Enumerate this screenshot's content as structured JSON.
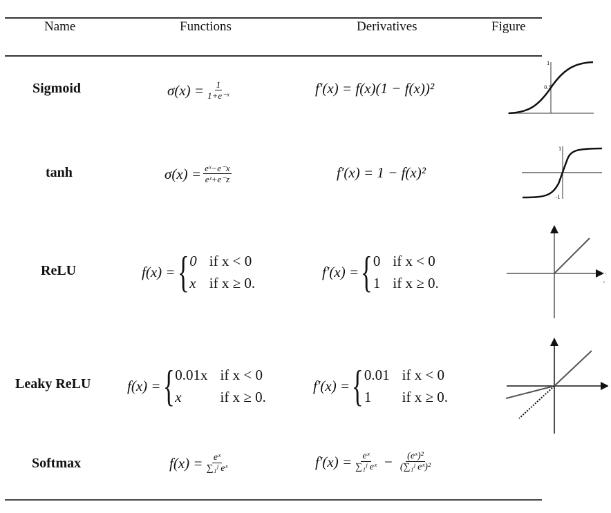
{
  "table": {
    "headers": {
      "name": "Name",
      "functions": "Functions",
      "derivatives": "Derivatives",
      "figure": "Figure"
    },
    "rows": [
      {
        "name": "Sigmoid",
        "function": {
          "lhs": "σ(x) =",
          "num": "1",
          "den": "1+e⁻ˣ"
        },
        "derivative": "f′(x) = f(x)(1 − f(x))²",
        "figure": {
          "type": "sigmoid",
          "labels": [
            "1",
            "0.5"
          ]
        }
      },
      {
        "name": "tanh",
        "function": {
          "lhs": "σ(x) =",
          "num": "eˣ−e⁻x",
          "den": "eᶻ+e⁻z"
        },
        "derivative": "f′(x) = 1 − f(x)²",
        "figure": {
          "type": "tanh",
          "labels": [
            "1",
            "-1"
          ]
        }
      },
      {
        "name": "ReLU",
        "function": {
          "lhs": "f(x) =",
          "cases": [
            [
              "0",
              "if x < 0"
            ],
            [
              "x",
              "if x ≥ 0."
            ]
          ]
        },
        "derivative": {
          "lhs": "f′(x) =",
          "cases": [
            [
              "0",
              "if x < 0"
            ],
            [
              "1",
              "if x ≥ 0."
            ]
          ]
        },
        "figure": {
          "type": "relu"
        }
      },
      {
        "name": "Leaky ReLU",
        "function": {
          "lhs": "f(x) =",
          "cases": [
            [
              "0.01x",
              "if x < 0"
            ],
            [
              "x",
              "if x ≥ 0."
            ]
          ]
        },
        "derivative": {
          "lhs": "f′(x) =",
          "cases": [
            [
              "0.01",
              "if x < 0"
            ],
            [
              "1",
              "if x ≥ 0."
            ]
          ]
        },
        "figure": {
          "type": "leaky-relu",
          "leak_slope": 0.2
        }
      },
      {
        "name": "Softmax",
        "function": {
          "lhs": "f(x) =",
          "num": "eˣ",
          "den": "∑₁ʲ eˣ"
        },
        "derivative": {
          "lhs": "f′(x) =",
          "t1_num": "eˣ",
          "t1_den": "∑₁ʲ eˣ",
          "op": "−",
          "t2_num": "(eˣ)²",
          "t2_den": "(∑₁ʲ eˣ)²"
        }
      }
    ]
  }
}
